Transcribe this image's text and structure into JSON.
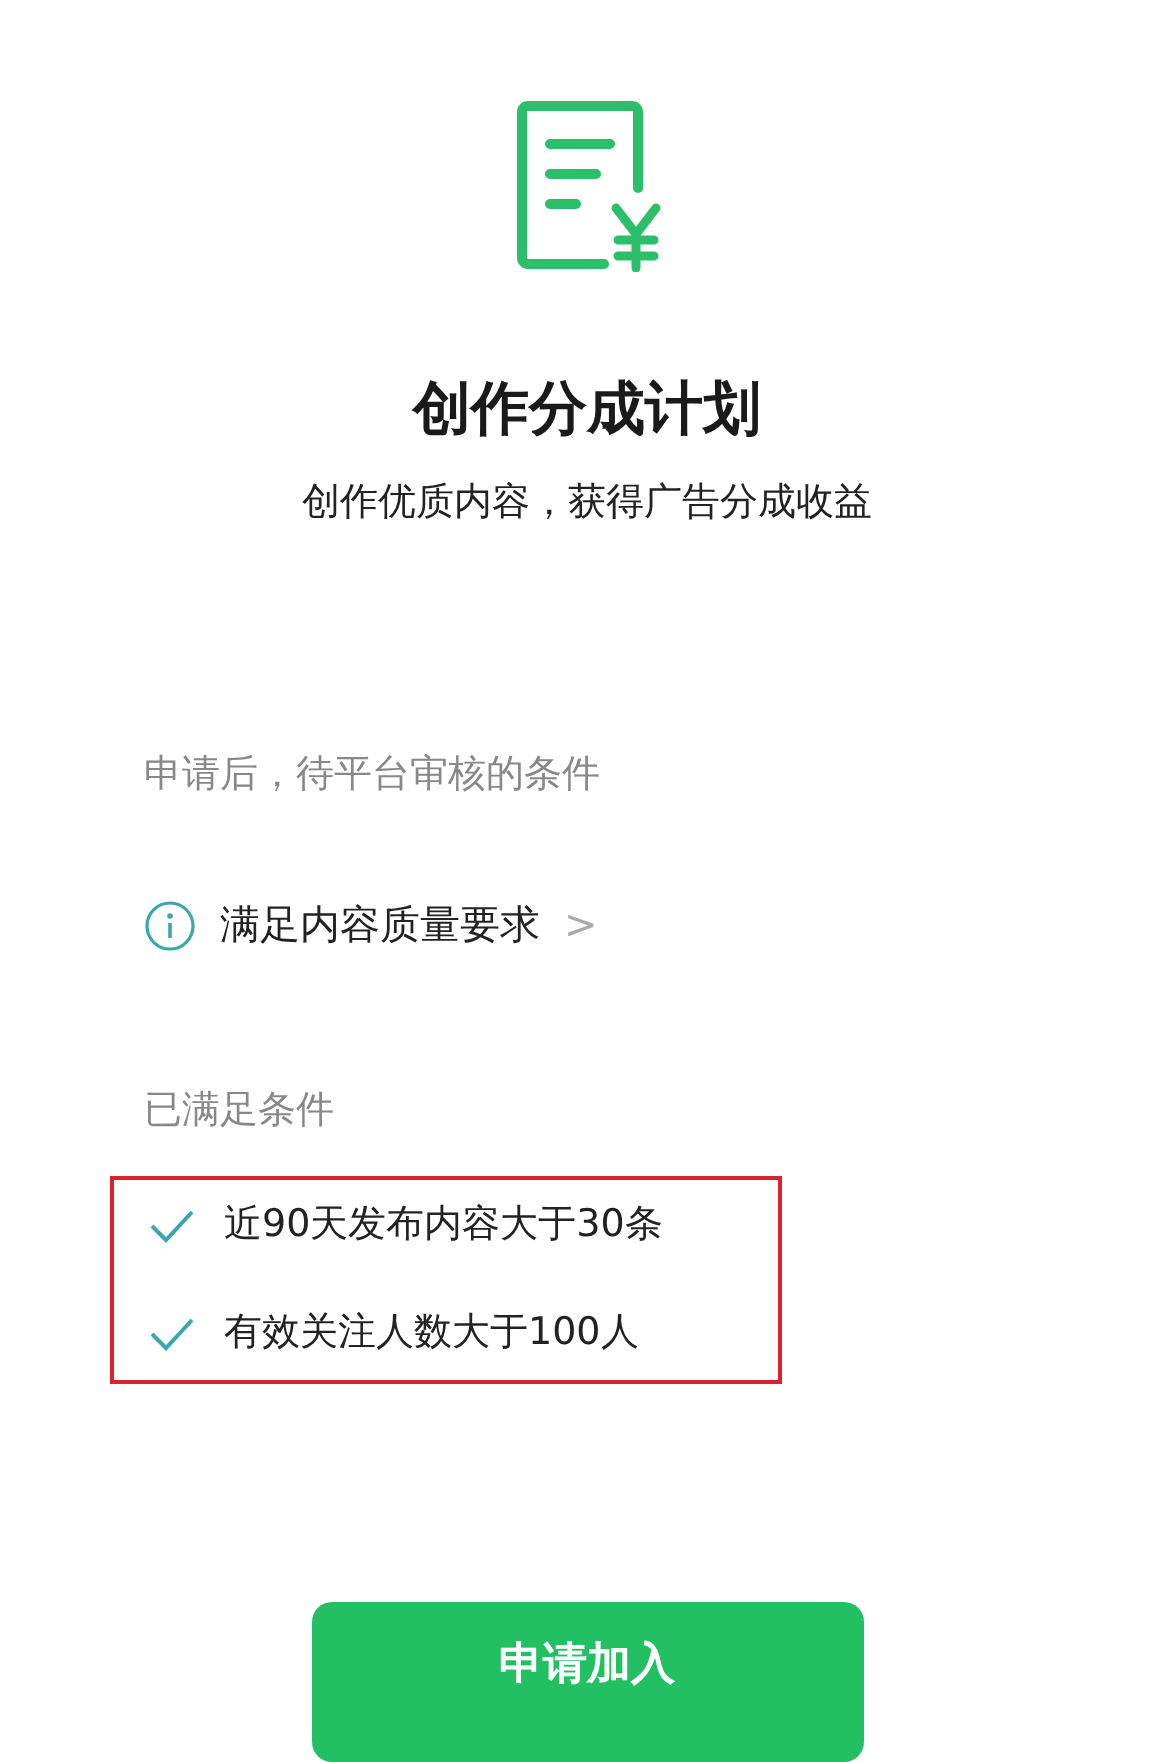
{
  "header": {
    "title": "创作分成计划",
    "subtitle": "创作优质内容，获得广告分成收益"
  },
  "pending_section": {
    "label": "申请后，待平台审核的条件",
    "items": [
      {
        "text": "满足内容质量要求",
        "chevron": ">"
      }
    ]
  },
  "met_section": {
    "label": "已满足条件",
    "highlighted": true,
    "items": [
      {
        "text": "近90天发布内容大于30条",
        "checked": true
      },
      {
        "text": "有效关注人数大于100人",
        "checked": true
      }
    ]
  },
  "apply_button": {
    "label": "申请加入"
  }
}
